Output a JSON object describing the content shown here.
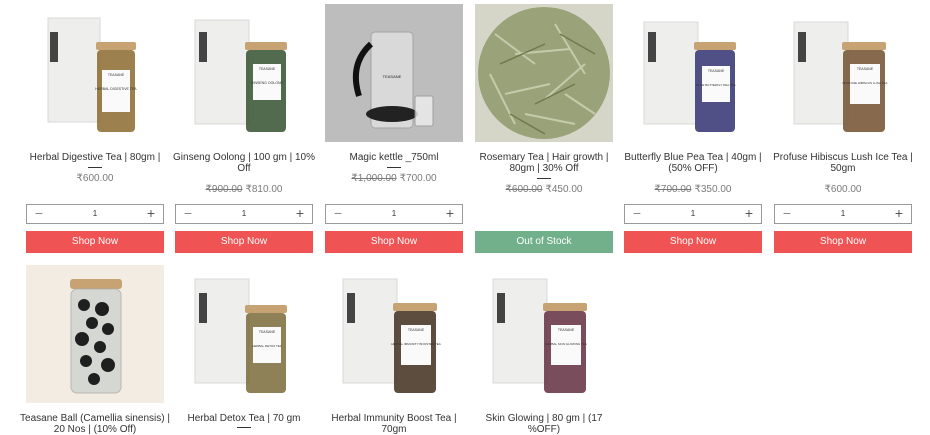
{
  "colors": {
    "shop": "#f05353",
    "out": "#72b08c"
  },
  "products": [
    {
      "name_l1": "Herbal Digestive Tea | 80gm |",
      "name_l2": "",
      "old_price": "",
      "price": "₹600.00",
      "qty": "1",
      "button": "Shop Now",
      "in_stock": true,
      "jar_label": "HERBAL DIGESTIVE TEA",
      "brand": "TEASANE"
    },
    {
      "name_l1": "Ginseng Oolong | 100 gm | 10%",
      "name_l2": "Off",
      "old_price": "₹900.00",
      "price": "₹810.00",
      "qty": "1",
      "button": "Shop Now",
      "in_stock": true,
      "jar_label": "GINSENG OOLONG",
      "brand": "TEASANE"
    },
    {
      "name_l1": "Magic kettle _750ml",
      "name_l2": "",
      "old_price": "₹1,000.00",
      "price": "₹700.00",
      "qty": "1",
      "button": "Shop Now",
      "in_stock": true,
      "jar_label": "",
      "brand": "TEASANE"
    },
    {
      "name_l1": "Rosemary Tea | Hair growth |",
      "name_l2": "80gm | 30% Off",
      "old_price": "₹600.00",
      "price": "₹450.00",
      "qty": "",
      "button": "Out of Stock",
      "in_stock": false,
      "jar_label": "",
      "brand": ""
    },
    {
      "name_l1": "Butterfly Blue Pea Tea | 40gm |",
      "name_l2": "(50% OFF)",
      "old_price": "₹700.00",
      "price": "₹350.00",
      "qty": "1",
      "button": "Shop Now",
      "in_stock": true,
      "jar_label": "BLUE BUTTERFLY PEA TEA",
      "brand": "TEASANE"
    },
    {
      "name_l1": "Profuse Hibiscus Lush Ice Tea |",
      "name_l2": "50gm",
      "old_price": "",
      "price": "₹600.00",
      "qty": "1",
      "button": "Shop Now",
      "in_stock": true,
      "jar_label": "PROFUSE HIBISCUS LUSH TEA",
      "brand": "TEASANE"
    },
    {
      "name_l1": "Teasane Ball (Camellia sinensis) |",
      "name_l2": "20 Nos | (10% Off)",
      "old_price": "",
      "price": "",
      "qty": "",
      "button": "",
      "in_stock": true,
      "jar_label": "",
      "brand": ""
    },
    {
      "name_l1": "Herbal Detox Tea | 70 gm",
      "name_l2": "",
      "old_price": "",
      "price": "",
      "qty": "",
      "button": "",
      "in_stock": true,
      "jar_label": "HERBAL DETOX TEA",
      "brand": "TEASANE"
    },
    {
      "name_l1": "Herbal Immunity Boost Tea |",
      "name_l2": "70gm",
      "old_price": "",
      "price": "",
      "qty": "",
      "button": "",
      "in_stock": true,
      "jar_label": "HERBAL IMMUNITY BOOSTER TEA",
      "brand": "TEASANE"
    },
    {
      "name_l1": "Skin Glowing | 80 gm | (17",
      "name_l2": "%OFF)",
      "old_price": "",
      "price": "",
      "qty": "",
      "button": "",
      "in_stock": true,
      "jar_label": "HERBAL SKIN GLOWING TEA",
      "brand": "TEASANE"
    }
  ]
}
